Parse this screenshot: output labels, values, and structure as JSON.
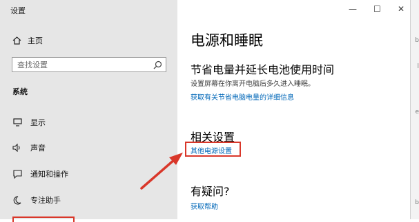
{
  "window": {
    "title": "设置"
  },
  "sidebar": {
    "home_label": "主页",
    "search_placeholder": "查找设置",
    "section_title": "系统",
    "items": [
      {
        "label": "显示",
        "icon": "display-icon"
      },
      {
        "label": "声音",
        "icon": "sound-icon"
      },
      {
        "label": "通知和操作",
        "icon": "notification-icon"
      },
      {
        "label": "专注助手",
        "icon": "moon-icon"
      }
    ]
  },
  "main": {
    "page_title": "电源和睡眠",
    "battery_heading": "节省电量并延长电池使用时间",
    "battery_desc": "设置屏幕在你离开电脑后多久进入睡眠。",
    "battery_link": "获取有关节省电脑电量的详细信息",
    "related_heading": "相关设置",
    "related_link": "其他电源设置",
    "help_heading": "有疑问?",
    "help_link": "获取帮助"
  },
  "titlebar": {
    "minimize": "—",
    "maximize": "☐",
    "close": "✕"
  },
  "colors": {
    "link": "#0067b8",
    "highlight": "#d9372a",
    "sidebar_bg": "#e6e6e6"
  }
}
